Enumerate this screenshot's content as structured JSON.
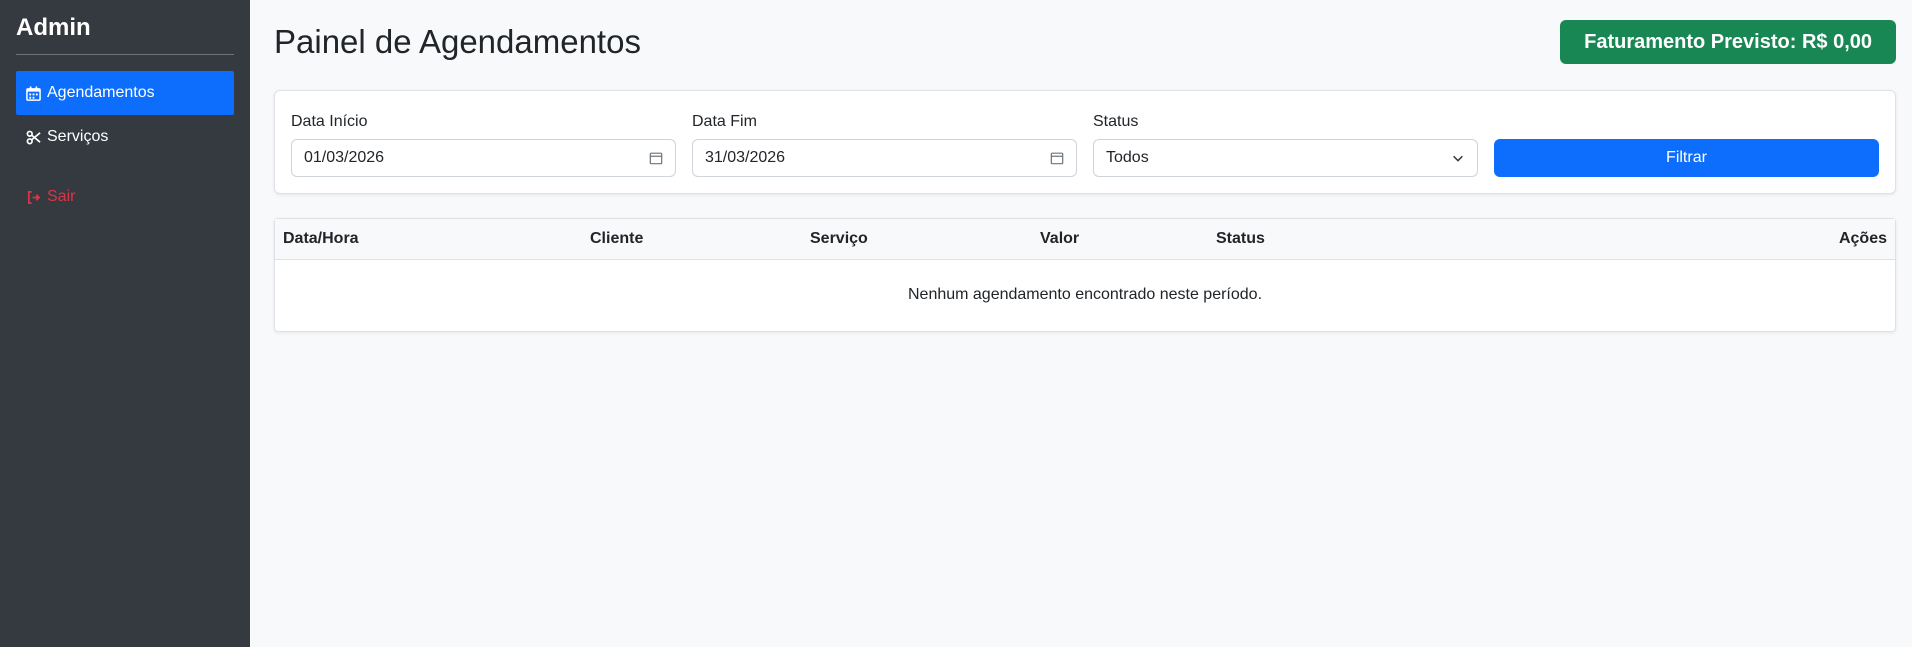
{
  "sidebar": {
    "brand": "Admin",
    "items": [
      {
        "label": "Agendamentos",
        "icon": "calendar-icon"
      },
      {
        "label": "Serviços",
        "icon": "scissors-icon"
      }
    ],
    "logout_label": "Sair"
  },
  "header": {
    "title": "Painel de Agendamentos",
    "revenue": "Faturamento Previsto: R$ 0,00"
  },
  "filters": {
    "start_label": "Data Início",
    "start_value": "01/03/2026",
    "end_label": "Data Fim",
    "end_value": "31/03/2026",
    "status_label": "Status",
    "status_value": "Todos",
    "button_label": "Filtrar"
  },
  "table": {
    "columns": [
      "Data/Hora",
      "Cliente",
      "Serviço",
      "Valor",
      "Status",
      "Ações"
    ],
    "empty_message": "Nenhum agendamento encontrado neste período."
  },
  "colors": {
    "sidebar_bg": "#343a40",
    "primary": "#0d6efd",
    "success": "#198754",
    "danger": "#dc3545"
  }
}
